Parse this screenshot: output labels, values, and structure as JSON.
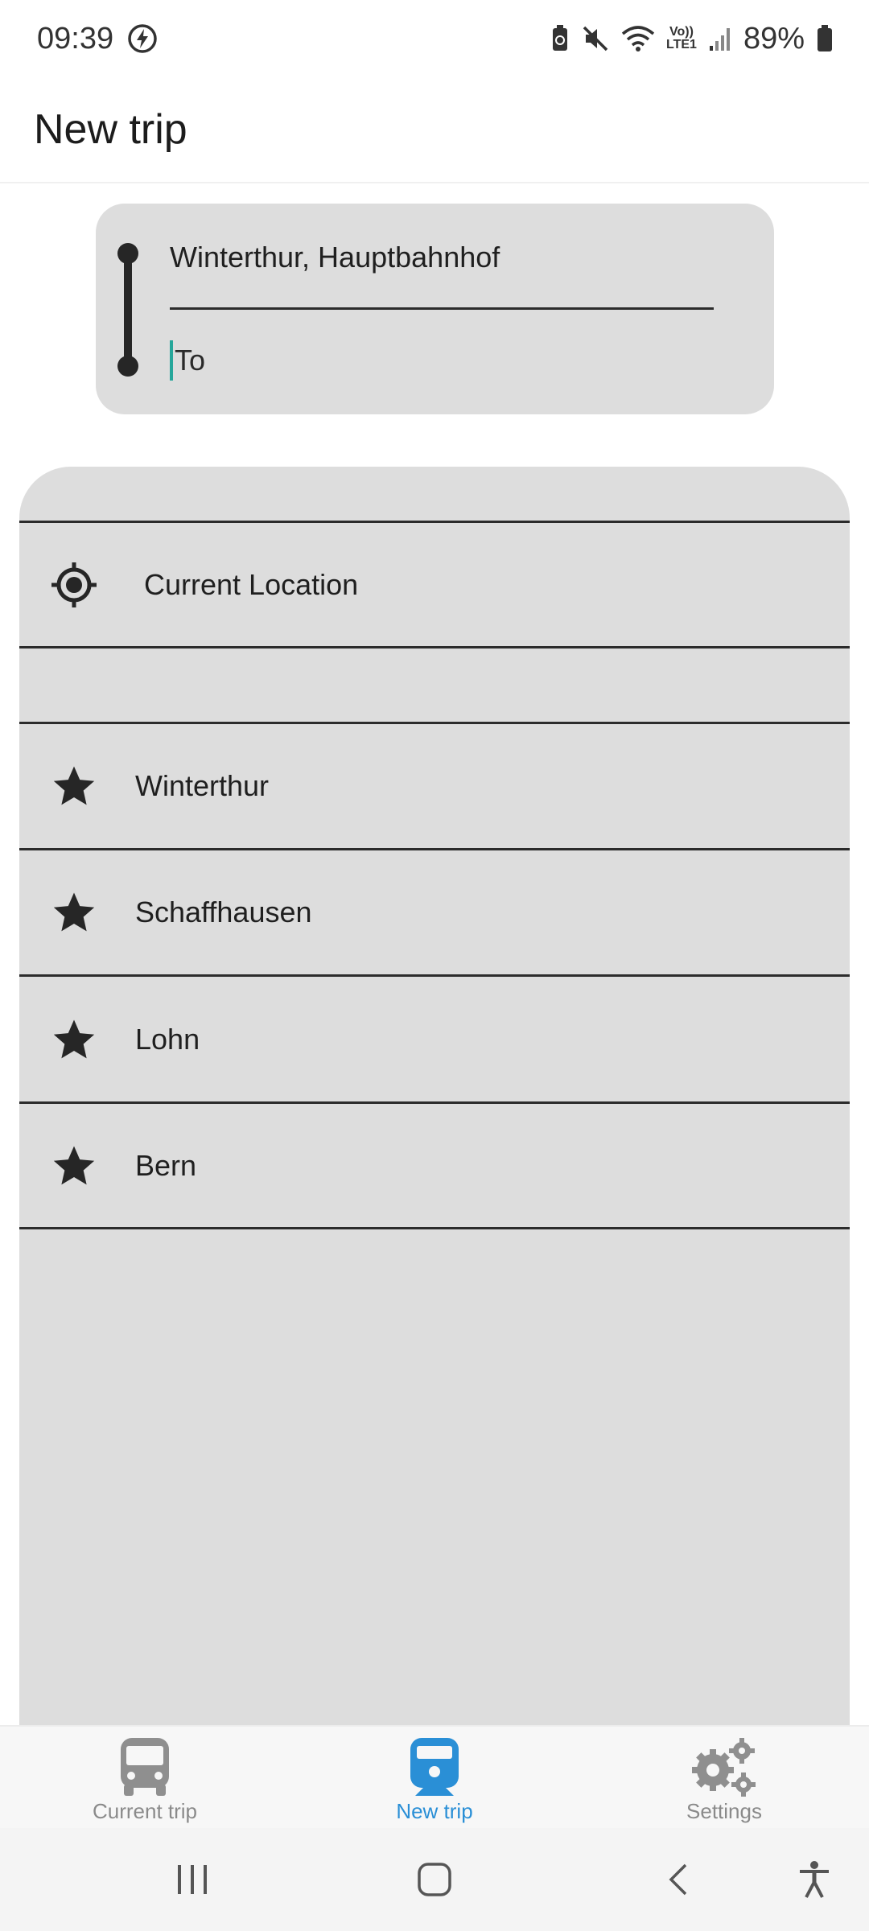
{
  "status_bar": {
    "time": "09:39",
    "battery": "89%",
    "network_label": "LTE1",
    "volte_label": "Vo))",
    "icons": [
      "flash-icon",
      "battery-saver-icon",
      "mute-icon",
      "wifi-icon",
      "volte-icon",
      "signal-icon",
      "battery-icon"
    ]
  },
  "app_bar": {
    "title": "New trip"
  },
  "route": {
    "from_value": "Winterthur, Hauptbahnhof",
    "to_placeholder": "To",
    "to_value": ""
  },
  "suggestions": {
    "current_location_label": "Current Location",
    "favorites": [
      {
        "label": "Winterthur",
        "icon": "star-icon"
      },
      {
        "label": "Schaffhausen",
        "icon": "star-icon"
      },
      {
        "label": "Lohn",
        "icon": "star-icon"
      },
      {
        "label": "Bern",
        "icon": "star-icon"
      }
    ]
  },
  "bottom_nav": {
    "items": [
      {
        "label": "Current trip",
        "icon": "bus-icon",
        "active": false
      },
      {
        "label": "New trip",
        "icon": "train-icon",
        "active": true
      },
      {
        "label": "Settings",
        "icon": "gear-icon",
        "active": false
      }
    ]
  },
  "colors": {
    "accent": "#2a8fd6",
    "panel_bg": "#dddddd",
    "caret": "#26a69a",
    "inactive": "#8a8a8a"
  }
}
